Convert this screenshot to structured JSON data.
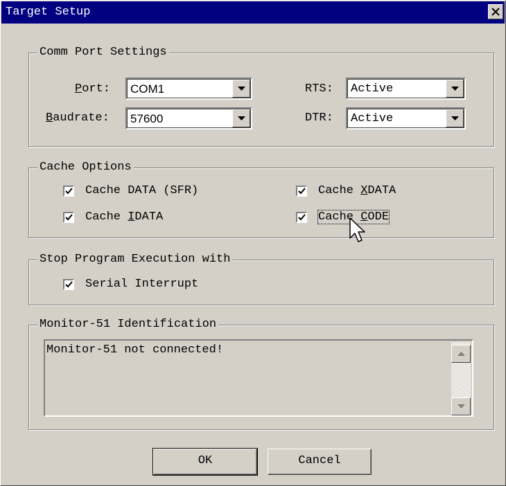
{
  "window": {
    "title": "Target Setup"
  },
  "comm": {
    "legend": "Comm Port Settings",
    "port_label_mn": "P",
    "port_label_rest": "ort:",
    "port_value": "COM1",
    "baud_label_mn": "B",
    "baud_label_rest": "audrate:",
    "baud_value": "57600",
    "rts_label": "RTS:",
    "rts_value": "Active",
    "dtr_label": "DTR:",
    "dtr_value": "Active"
  },
  "cache": {
    "legend": "Cache Options",
    "data_sfr": {
      "label": "Cache DATA (SFR)",
      "checked": true
    },
    "xdata": {
      "pre": "Cache ",
      "mn": "X",
      "post": "DATA",
      "checked": true
    },
    "idata": {
      "pre": "Cache ",
      "mn": "I",
      "post": "DATA",
      "checked": true
    },
    "code": {
      "pre": "Cache ",
      "mn": "C",
      "post": "ODE",
      "checked": true
    }
  },
  "stop": {
    "legend": "Stop Program Execution with",
    "serial_interrupt": {
      "label": "Serial Interrupt",
      "checked": true
    }
  },
  "monitor": {
    "legend": "Monitor-51 Identification",
    "text": "Monitor-51 not connected!"
  },
  "buttons": {
    "ok": "OK",
    "cancel": "Cancel"
  },
  "icons": [
    "close-icon",
    "dropdown-arrow-icon",
    "checkmark-icon",
    "scroll-up-icon",
    "scroll-down-icon",
    "mouse-cursor-icon"
  ]
}
